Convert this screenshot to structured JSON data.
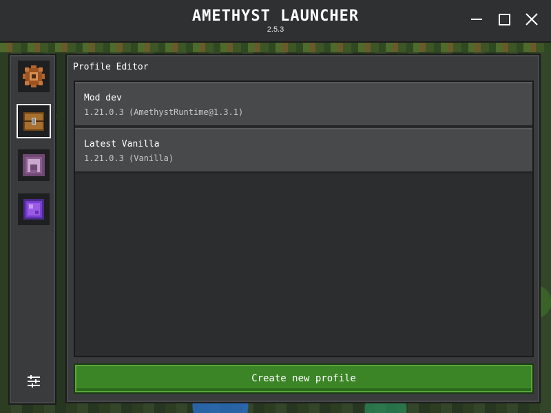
{
  "window": {
    "title": "AMETHYST LAUNCHER",
    "version": "2.5.3"
  },
  "sidebar": {
    "items": [
      {
        "icon": "gear-icon",
        "active": false
      },
      {
        "icon": "chest-icon",
        "active": true
      },
      {
        "icon": "helmet-icon",
        "active": false
      },
      {
        "icon": "amethyst-block-icon",
        "active": false
      }
    ],
    "settings_icon": "sliders-icon"
  },
  "main": {
    "title": "Profile Editor",
    "profiles": [
      {
        "name": "Mod dev",
        "version": "1.21.0.3 (AmethystRuntime@1.3.1)"
      },
      {
        "name": "Latest Vanilla",
        "version": "1.21.0.3 (Vanilla)"
      }
    ],
    "create_button_label": "Create new profile"
  },
  "colors": {
    "titlebar": "#2f3032",
    "panel": "#3a3b3d",
    "list_background": "#2c2d2f",
    "profile_item": "#48494b",
    "create_button": "#3c8527"
  }
}
